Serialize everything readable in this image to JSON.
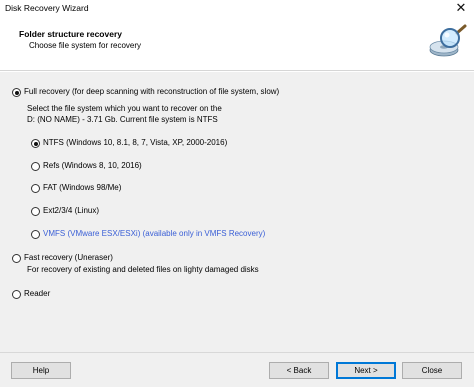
{
  "window": {
    "title": "Disk Recovery Wizard",
    "close_glyph": "✕"
  },
  "header": {
    "title": "Folder structure recovery",
    "subtitle": "Choose file system for recovery",
    "icon": "magnifier-disk-icon"
  },
  "options": {
    "full_recovery": {
      "label": "Full recovery (for deep scanning with reconstruction of file system, slow)",
      "selected": true
    },
    "description_line1": "Select the file system which you want to recover on the",
    "description_line2": "D: (NO NAME) - 3.71 Gb. Current file system is NTFS",
    "filesystems": [
      {
        "label": "NTFS (Windows 10, 8.1, 8, 7, Vista, XP, 2000-2016)",
        "selected": true
      },
      {
        "label": "Refs (Windows 8, 10, 2016)",
        "selected": false
      },
      {
        "label": "FAT (Windows 98/Me)",
        "selected": false
      },
      {
        "label": "Ext2/3/4 (Linux)",
        "selected": false
      },
      {
        "label": "VMFS (VMware ESX/ESXi) (available only in VMFS Recovery)",
        "selected": false,
        "color": "#3a5fd6"
      }
    ],
    "fast_recovery": {
      "label": "Fast recovery (Uneraser)",
      "selected": false
    },
    "fast_recovery_desc": "For recovery of existing and deleted files on lighty damaged disks",
    "reader": {
      "label": "Reader",
      "selected": false
    }
  },
  "footer": {
    "help_label": "Help",
    "back_label": "< Back",
    "next_label": "Next >",
    "close_label": "Close"
  }
}
